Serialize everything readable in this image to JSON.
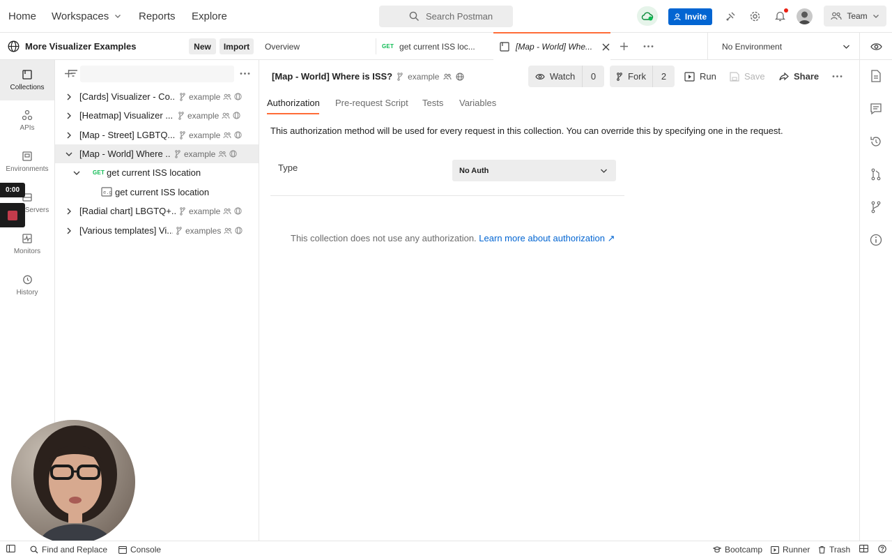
{
  "topbar": {
    "nav": [
      "Home",
      "Workspaces",
      "Reports",
      "Explore"
    ],
    "search_placeholder": "Search Postman",
    "invite_label": "Invite",
    "team_label": "Team"
  },
  "workspace": {
    "title": "More Visualizer Examples",
    "new_label": "New",
    "import_label": "Import"
  },
  "rail": {
    "items": [
      "Collections",
      "APIs",
      "Environments",
      "Servers",
      "Monitors",
      "History"
    ],
    "recording_time": "0:00"
  },
  "tree": {
    "rows": [
      {
        "name": "[Cards] Visualizer - Co...",
        "fork": "example"
      },
      {
        "name": "[Heatmap] Visualizer ...",
        "fork": "example"
      },
      {
        "name": "[Map - Street] LGBTQ...",
        "fork": "example"
      },
      {
        "name": "[Map - World] Where ...",
        "fork": "example"
      },
      {
        "name": "get current ISS location",
        "method": "GET"
      },
      {
        "name": "get current ISS location"
      },
      {
        "name": "[Radial chart] LBGTQ+...",
        "fork": "example"
      },
      {
        "name": "[Various templates] Vi...",
        "fork": "examples"
      }
    ]
  },
  "tabs": {
    "overview": "Overview",
    "request_method": "GET",
    "request_tab": "get current ISS loc...",
    "collection_tab": "[Map - World] Whe...",
    "environment": "No Environment"
  },
  "collection": {
    "name": "[Map - World] Where is ISS?",
    "fork_label": "example",
    "watch_label": "Watch",
    "watch_count": "0",
    "fork_btn_label": "Fork",
    "fork_count": "2",
    "run_label": "Run",
    "save_label": "Save",
    "share_label": "Share"
  },
  "content_tabs": [
    "Authorization",
    "Pre-request Script",
    "Tests",
    "Variables"
  ],
  "auth": {
    "description": "This authorization method will be used for every request in this collection. You can override this by specifying one in the request.",
    "type_label": "Type",
    "type_value": "No Auth",
    "no_auth_text": "This collection does not use any authorization.",
    "learn_more": "Learn more about authorization ↗"
  },
  "statusbar": {
    "find_replace": "Find and Replace",
    "console": "Console",
    "bootcamp": "Bootcamp",
    "runner": "Runner",
    "trash": "Trash"
  },
  "colors": {
    "accent": "#ff6c37",
    "invite_blue": "#0265d2",
    "get_green": "#0cbb52"
  }
}
